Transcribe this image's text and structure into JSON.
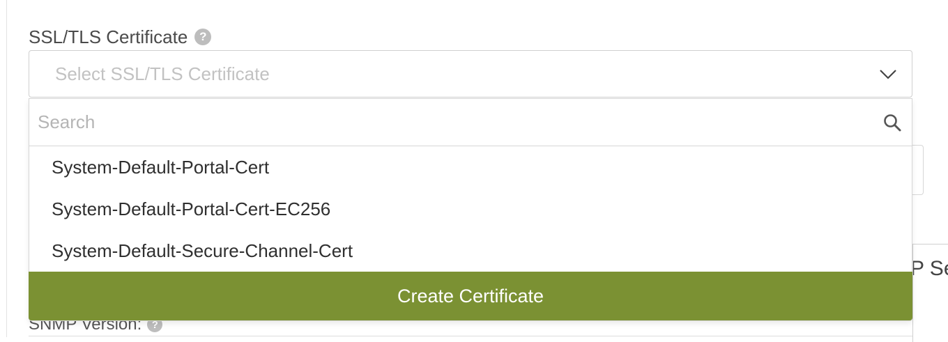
{
  "ssl_field": {
    "label": "SSL/TLS Certificate",
    "help_icon": "question-circle-icon",
    "placeholder": "Select SSL/TLS Certificate",
    "chevron_icon": "chevron-down-icon"
  },
  "dropdown": {
    "search_placeholder": "Search",
    "search_icon": "search-icon",
    "options": [
      {
        "label": "System-Default-Portal-Cert"
      },
      {
        "label": "System-Default-Portal-Cert-EC256"
      },
      {
        "label": "System-Default-Secure-Channel-Cert"
      }
    ],
    "create_button_label": "Create Certificate"
  },
  "background": {
    "partial_panel_text": "P Se",
    "snmp_label": "SNMP Version:"
  },
  "colors": {
    "accent_button": "#7b9133",
    "help_icon": "#bdbdbd"
  }
}
